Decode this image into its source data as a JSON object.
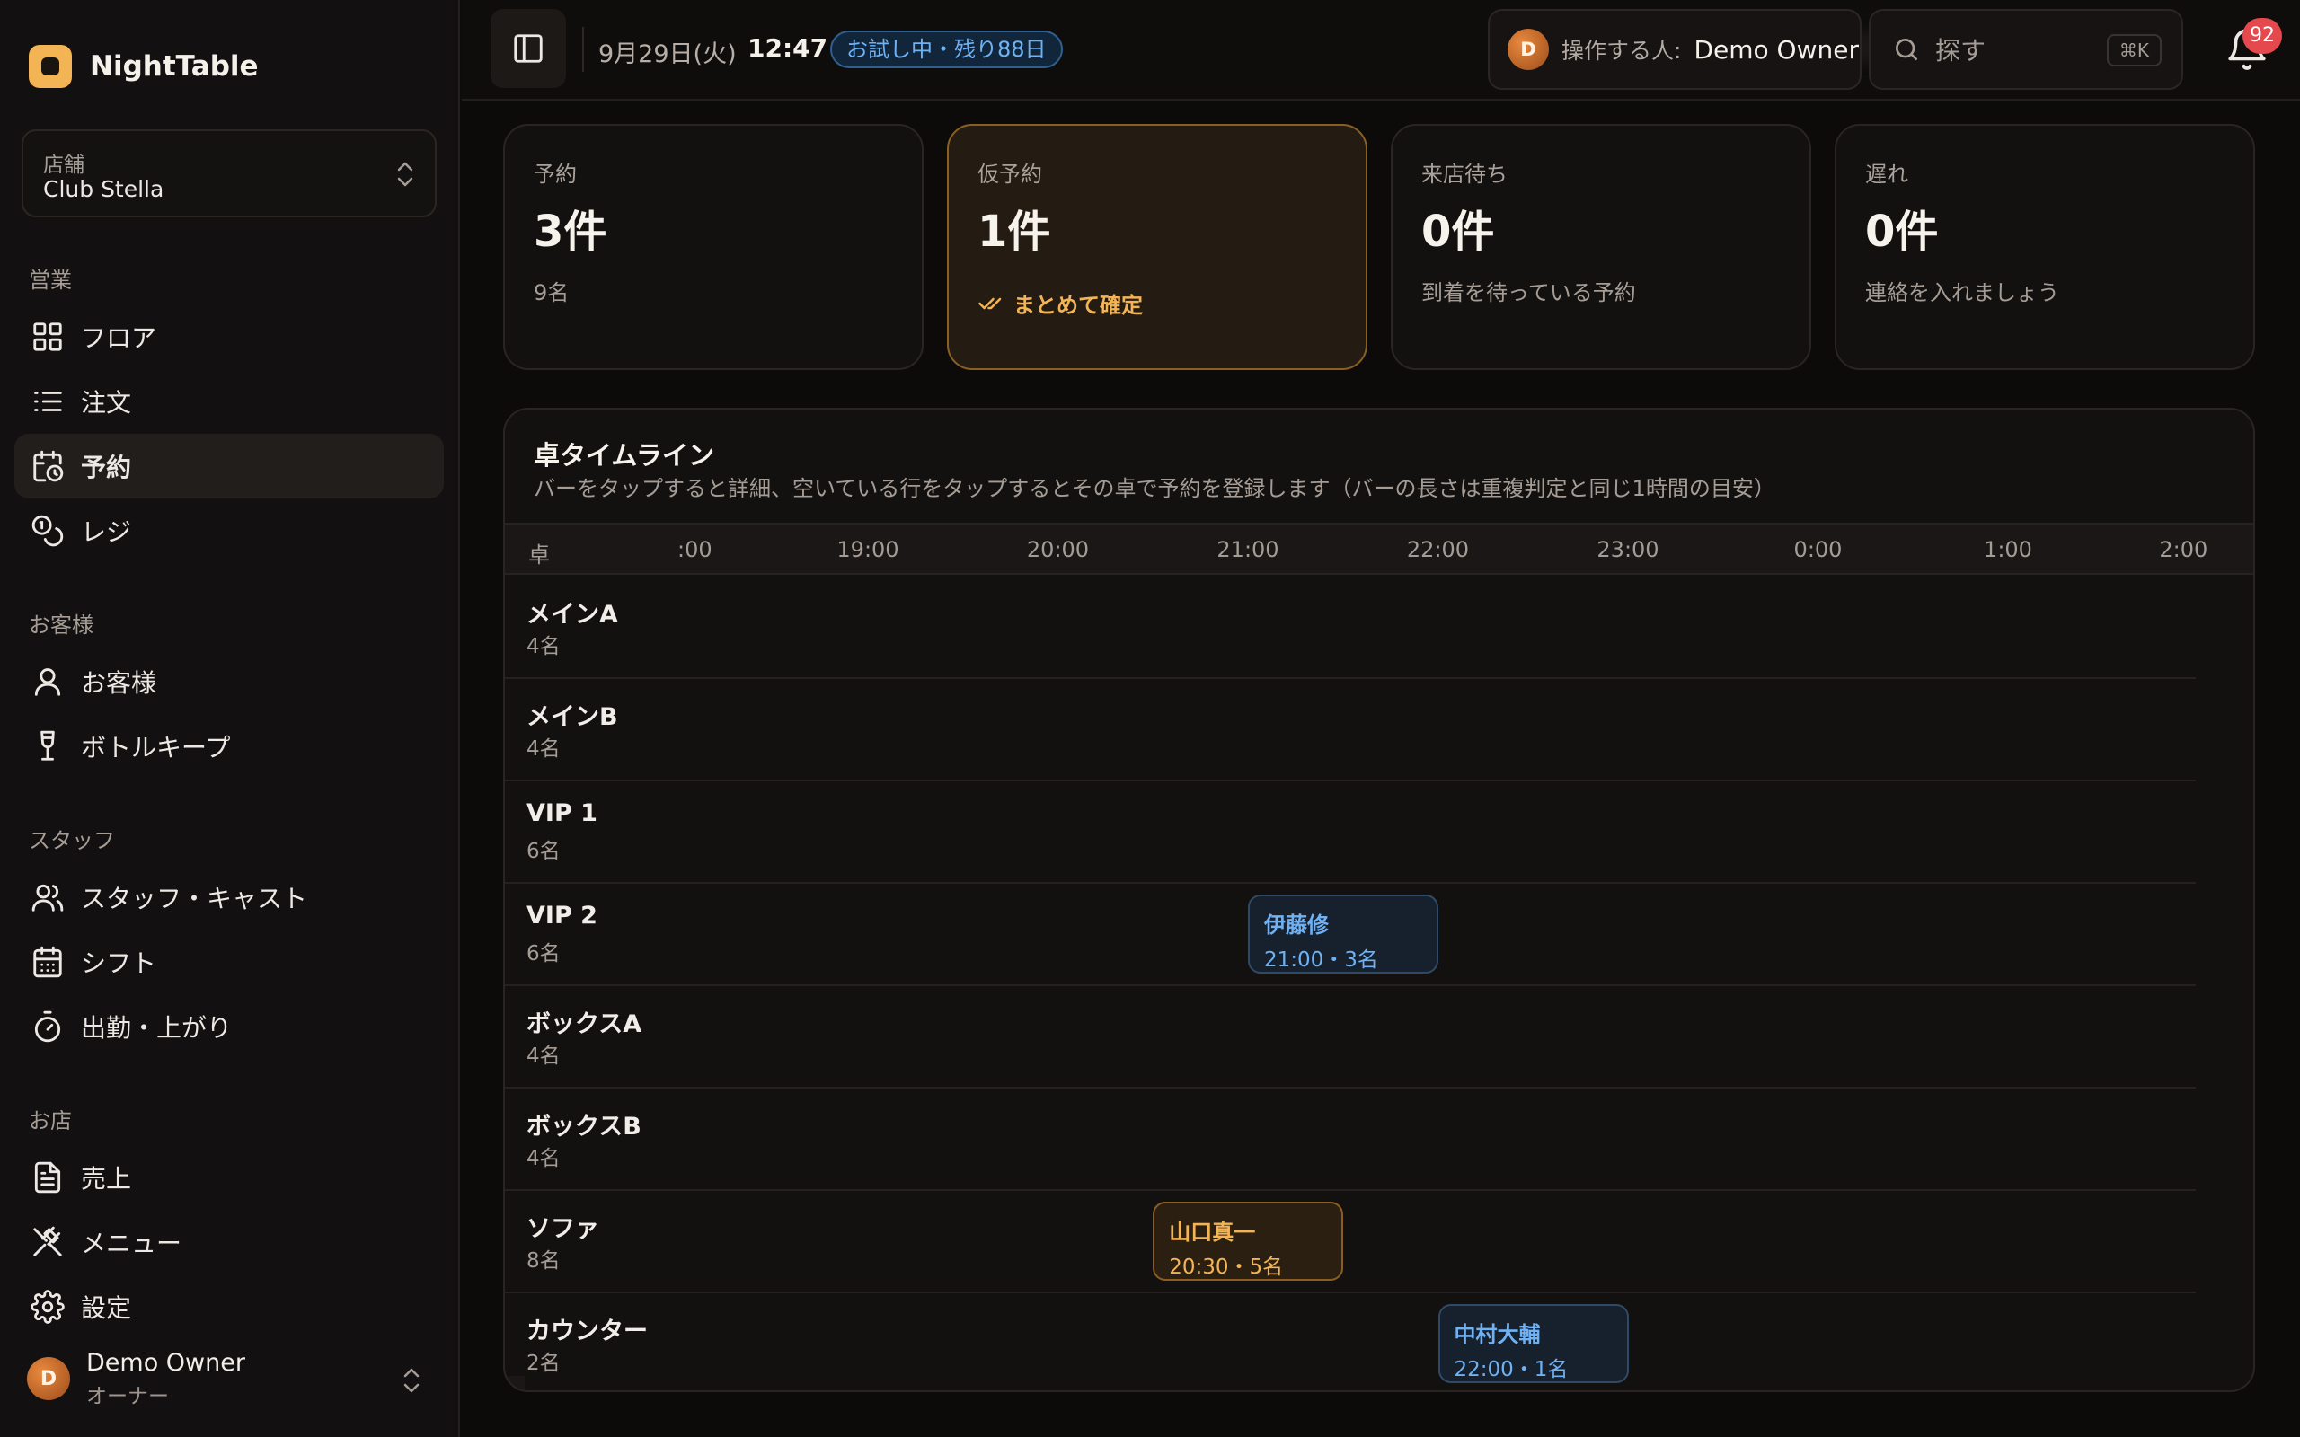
{
  "brand": {
    "name": "NightTable"
  },
  "store": {
    "label": "店舗",
    "value": "Club Stella"
  },
  "sidebar": {
    "sections": [
      {
        "title": "営業",
        "items": [
          {
            "label": "フロア",
            "icon": "grid-icon"
          },
          {
            "label": "注文",
            "icon": "list-icon"
          },
          {
            "label": "予約",
            "icon": "calendar-clock-icon",
            "active": true
          },
          {
            "label": "レジ",
            "icon": "coins-icon"
          }
        ]
      },
      {
        "title": "お客様",
        "items": [
          {
            "label": "お客様",
            "icon": "user-icon"
          },
          {
            "label": "ボトルキープ",
            "icon": "wine-icon"
          }
        ]
      },
      {
        "title": "スタッフ",
        "items": [
          {
            "label": "スタッフ・キャスト",
            "icon": "users-icon"
          },
          {
            "label": "シフト",
            "icon": "calendar-icon"
          },
          {
            "label": "出勤・上がり",
            "icon": "timer-icon"
          }
        ]
      },
      {
        "title": "お店",
        "items": [
          {
            "label": "売上",
            "icon": "file-text-icon"
          },
          {
            "label": "メニュー",
            "icon": "utensils-icon"
          },
          {
            "label": "設定",
            "icon": "gear-icon"
          }
        ]
      }
    ]
  },
  "user": {
    "initial": "D",
    "name": "Demo Owner",
    "role": "オーナー"
  },
  "header": {
    "date": "9月29日(火)",
    "time": "12:47",
    "trial_badge": "お試し中・残り88日",
    "operator_label": "操作する人:",
    "operator_initial": "D",
    "operator_name": "Demo Owner",
    "search_placeholder": "探す",
    "search_shortcut": "⌘K",
    "notification_count": "92"
  },
  "stats": [
    {
      "label": "予約",
      "value": "3件",
      "sub": "9名"
    },
    {
      "label": "仮予約",
      "value": "1件",
      "action": "まとめて確定",
      "highlight": true
    },
    {
      "label": "来店待ち",
      "value": "0件",
      "sub": "到着を待っている予約"
    },
    {
      "label": "遅れ",
      "value": "0件",
      "sub": "連絡を入れましょう"
    }
  ],
  "timeline": {
    "title": "卓タイムライン",
    "description": "バーをタップすると詳細、空いている行をタップするとその卓で予約を登録します（バーの長さは重複判定と同じ1時間の目安）",
    "column_label": "卓",
    "ticks": [
      ":00",
      "19:00",
      "20:00",
      "21:00",
      "22:00",
      "23:00",
      "0:00",
      "1:00",
      "2:00"
    ],
    "tables": [
      {
        "name": "メインA",
        "capacity": "4名"
      },
      {
        "name": "メインB",
        "capacity": "4名"
      },
      {
        "name": "VIP 1",
        "capacity": "6名"
      },
      {
        "name": "VIP 2",
        "capacity": "6名"
      },
      {
        "name": "ボックスA",
        "capacity": "4名"
      },
      {
        "name": "ボックスB",
        "capacity": "4名"
      },
      {
        "name": "ソファ",
        "capacity": "8名"
      },
      {
        "name": "カウンター",
        "capacity": "2名"
      }
    ],
    "reservations": [
      {
        "table": "VIP 2",
        "name": "伊藤修",
        "meta": "21:00・3名",
        "start_hour": 21.0,
        "status": "confirmed"
      },
      {
        "table": "ソファ",
        "name": "山口真一",
        "meta": "20:30・5名",
        "start_hour": 20.5,
        "status": "tentative"
      },
      {
        "table": "カウンター",
        "name": "中村大輔",
        "meta": "22:00・1名",
        "start_hour": 22.0,
        "status": "confirmed"
      }
    ]
  },
  "colors": {
    "accent": "#f2b454",
    "info": "#6fb1f2",
    "danger": "#e5484d"
  }
}
